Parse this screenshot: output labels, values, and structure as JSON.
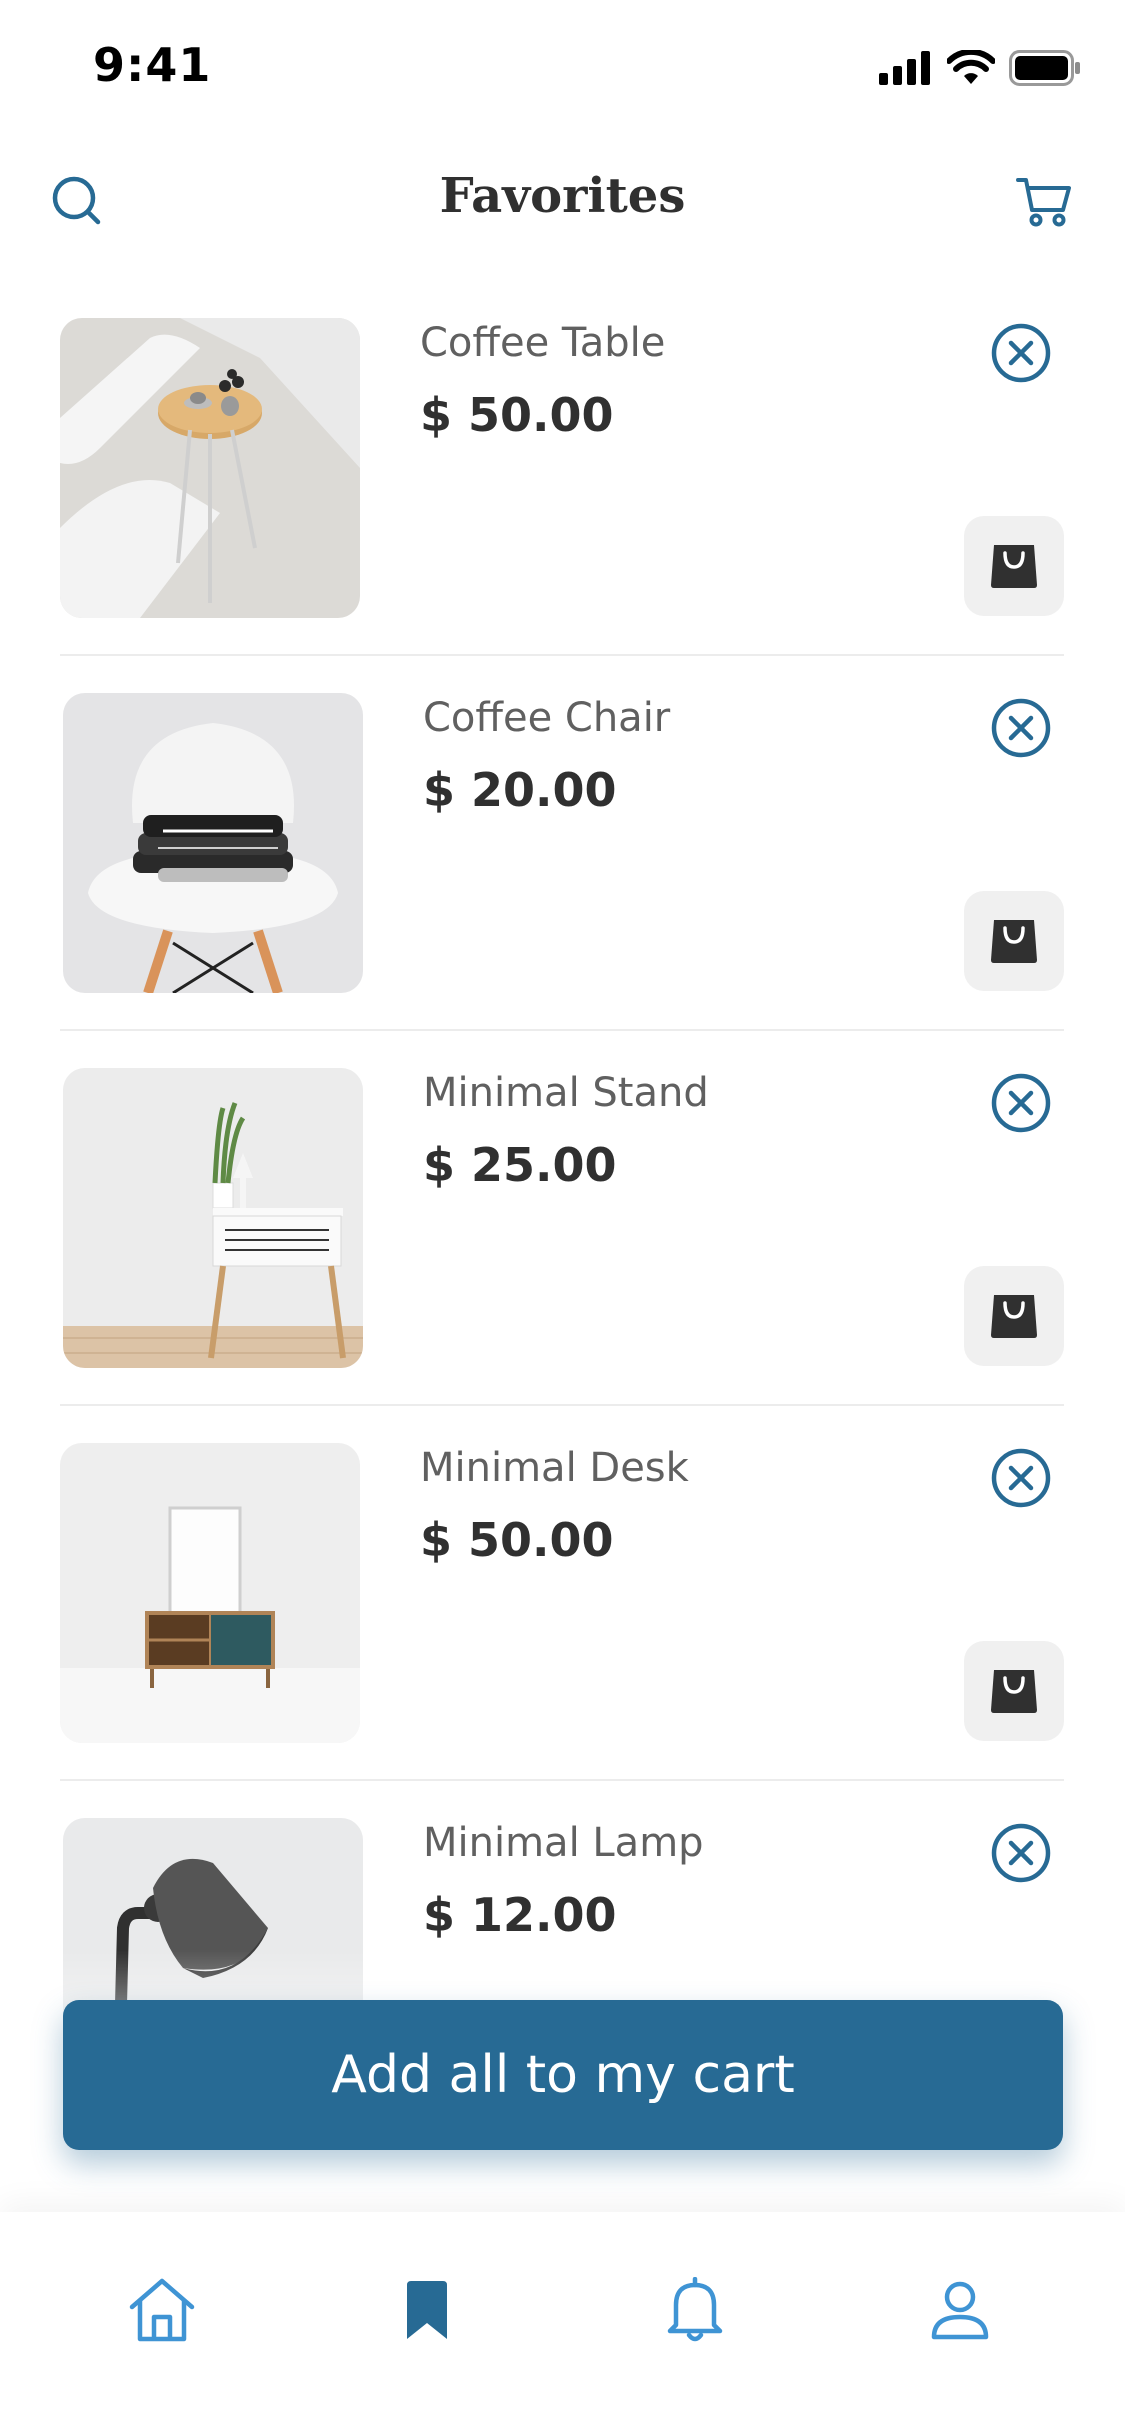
{
  "status_bar": {
    "time": "9:41"
  },
  "header": {
    "title": "Favorites"
  },
  "items": [
    {
      "name": "Coffee Table",
      "price": "$ 50.00"
    },
    {
      "name": "Coffee Chair",
      "price": "$ 20.00"
    },
    {
      "name": "Minimal Stand",
      "price": "$ 25.00"
    },
    {
      "name": "Minimal Desk",
      "price": "$ 50.00"
    },
    {
      "name": "Minimal Lamp",
      "price": "$ 12.00"
    }
  ],
  "cta": {
    "label": "Add all to my cart"
  },
  "tabbar": {
    "tabs": [
      {
        "icon": "home-icon"
      },
      {
        "icon": "bookmark-icon",
        "active": true
      },
      {
        "icon": "bell-icon"
      },
      {
        "icon": "user-icon"
      }
    ]
  },
  "colors": {
    "accent": "#276a94",
    "title_text": "#303030",
    "secondary_text": "#606060",
    "button_bg": "#f0f0f0"
  }
}
